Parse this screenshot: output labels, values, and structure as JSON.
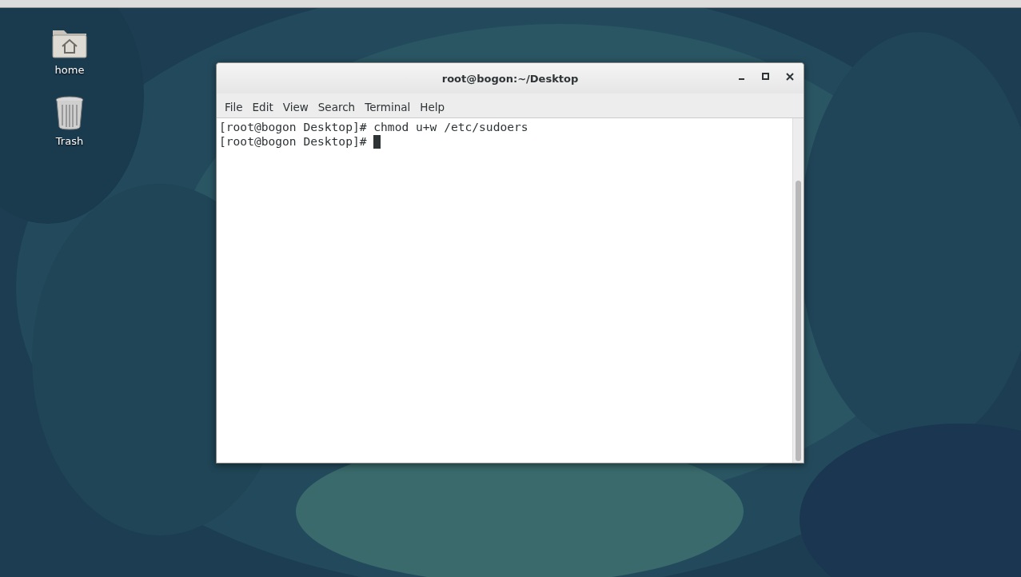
{
  "desktop_icons": [
    {
      "label": "home",
      "kind": "folder"
    },
    {
      "label": "Trash",
      "kind": "trash"
    }
  ],
  "terminal": {
    "title": "root@bogon:~/Desktop",
    "menu": [
      "File",
      "Edit",
      "View",
      "Search",
      "Terminal",
      "Help"
    ],
    "lines": [
      "[root@bogon Desktop]# chmod u+w /etc/sudoers",
      "[root@bogon Desktop]# "
    ],
    "cursor_visible": true
  }
}
